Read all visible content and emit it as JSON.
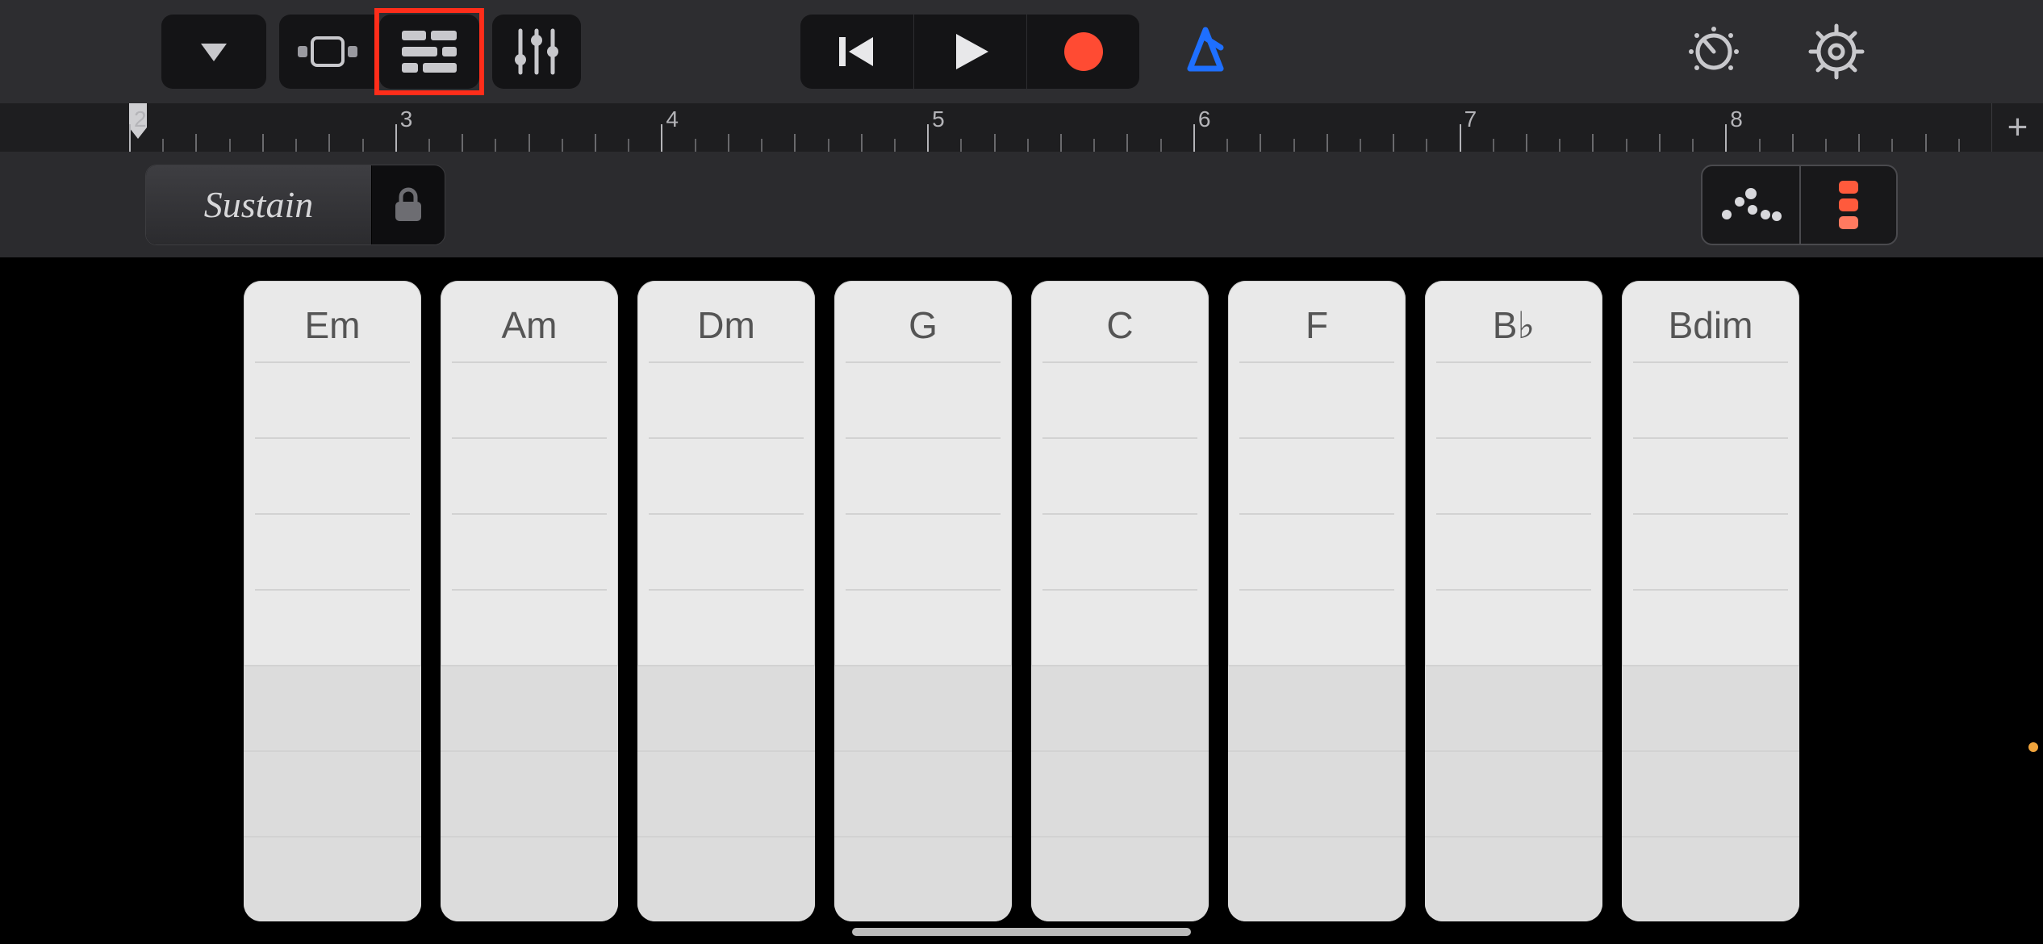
{
  "toolbar": {
    "browser_btn": "browser",
    "view_group": {
      "note_view": "note-view",
      "track_view": "track-view"
    },
    "fx_btn": "fx",
    "transport": {
      "back": "go-to-beginning",
      "play": "play",
      "record": "record"
    },
    "metronome_on": true,
    "info_btn": "info",
    "settings_btn": "settings"
  },
  "ruler": {
    "start": 2,
    "end": 8,
    "labels": [
      "2",
      "3",
      "4",
      "5",
      "6",
      "7",
      "8"
    ],
    "add_label": "+"
  },
  "instrument": {
    "sustain_label": "Sustain",
    "lock": "lock",
    "view_mode": "chord-strips"
  },
  "chords": [
    "Em",
    "Am",
    "Dm",
    "G",
    "C",
    "F",
    "B♭",
    "Bdim"
  ],
  "colors": {
    "accent_blue": "#1e6fff",
    "record_red": "#ff4b33",
    "highlight_red": "#ff2d1a",
    "chord_active_red": "#ff4b33"
  }
}
